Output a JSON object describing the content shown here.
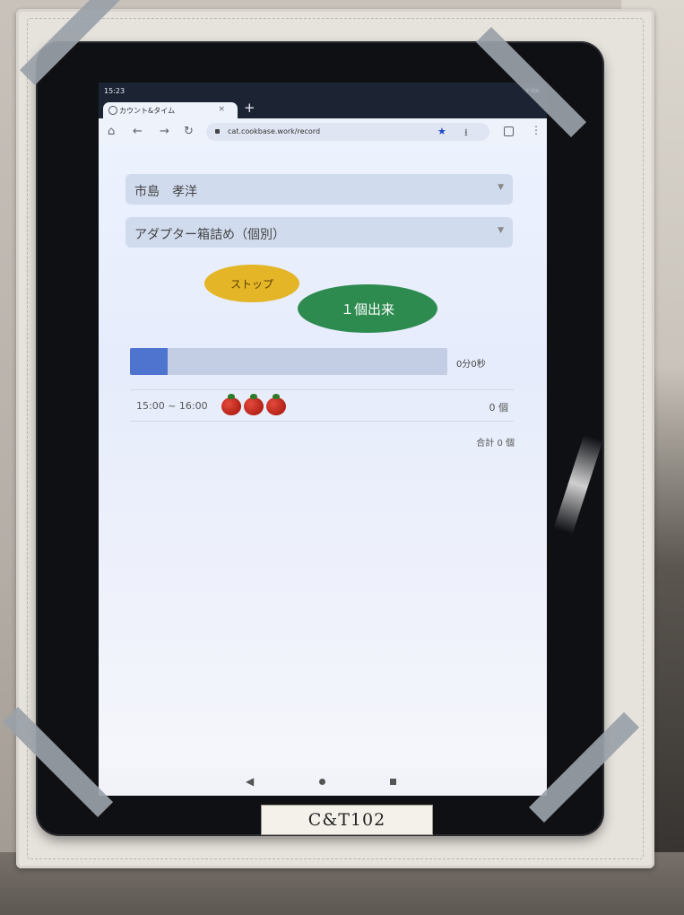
{
  "status_bar": {
    "time": "15:23",
    "icons_right": "▾◀▪"
  },
  "browser": {
    "tab_title": "カウント&タイム",
    "tab_close": "×",
    "new_tab": "+",
    "url": "cat.cookbase.work/record",
    "nav_icons": [
      "home-icon",
      "back-icon",
      "forward-icon",
      "reload-icon"
    ]
  },
  "form": {
    "worker_select": "市島　孝洋",
    "task_select": "アダプター箱詰め（個別）"
  },
  "buttons": {
    "stop": "ストップ",
    "done": "１個出来"
  },
  "timer": {
    "elapsed": "0分0秒",
    "progress_percent": 12
  },
  "hourly": [
    {
      "range": "15:00 ~ 16:00",
      "tomatoes": 3,
      "count": "0 個"
    }
  ],
  "total": "合計 0 個",
  "device_label": "C&T102",
  "colors": {
    "stop_button": "#e4b527",
    "done_button": "#2e8b4f",
    "progress_fill": "#4f74d0",
    "tomato": "#c4281c"
  }
}
